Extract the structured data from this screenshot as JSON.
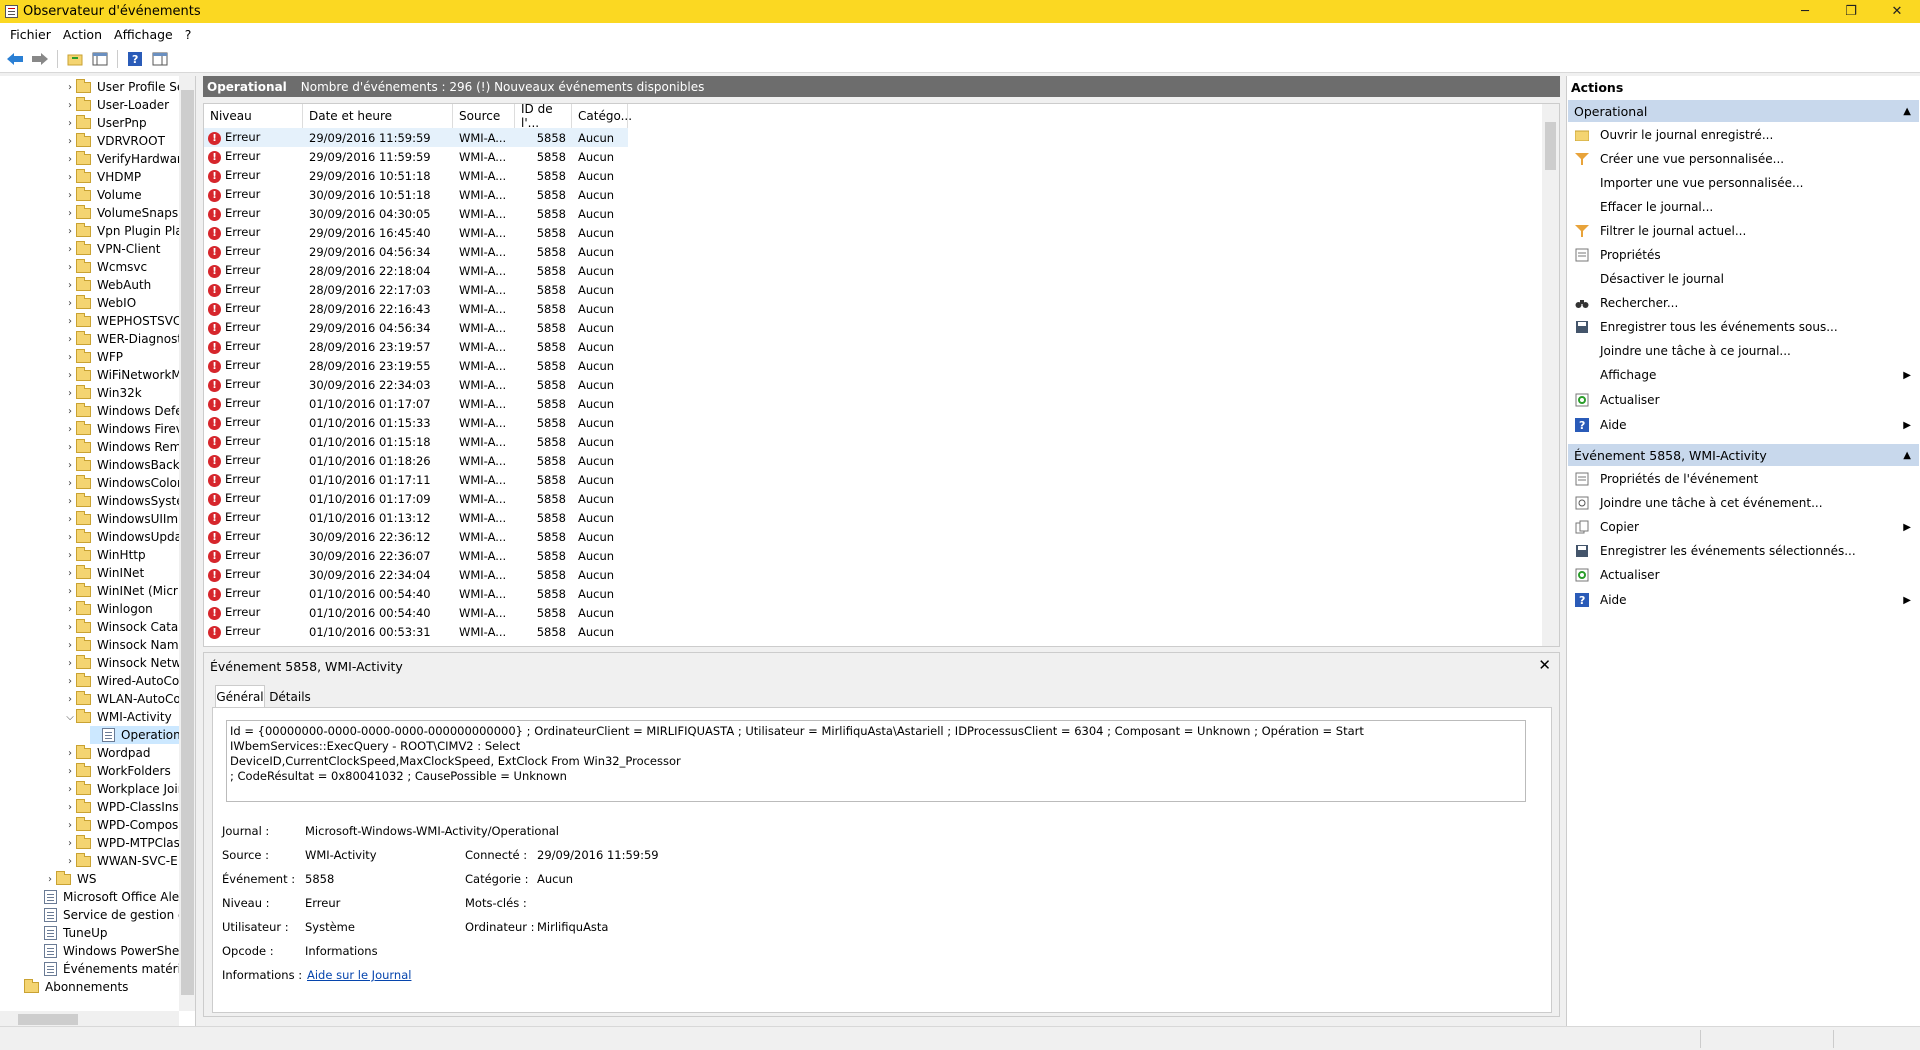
{
  "window": {
    "title": "Observateur d'événements",
    "minimize": "─",
    "maximize": "❐",
    "close": "✕"
  },
  "menu": [
    "Fichier",
    "Action",
    "Affichage",
    "?"
  ],
  "tree": {
    "items": [
      "User Profile Se",
      "User-Loader",
      "UserPnp",
      "VDRVROOT",
      "VerifyHardwar",
      "VHDMP",
      "Volume",
      "VolumeSnapsh",
      "Vpn Plugin Pla",
      "VPN-Client",
      "Wcmsvc",
      "WebAuth",
      "WebIO",
      "WEPHOSTSVC",
      "WER-Diagnost",
      "WFP",
      "WiFiNetworkM",
      "Win32k",
      "Windows Defe",
      "Windows Firev",
      "Windows Rem",
      "WindowsBack",
      "WindowsColor",
      "WindowsSyste",
      "WindowsUIIm",
      "WindowsUpda",
      "WinHttp",
      "WinINet",
      "WinINet (Micr",
      "Winlogon",
      "Winsock Catal",
      "Winsock Nam",
      "Winsock Netw",
      "Wired-AutoCo",
      "WLAN-AutoCo",
      "WMI-Activity"
    ],
    "selected_child": "Operationa",
    "after": [
      "Wordpad",
      "WorkFolders",
      "Workplace Joir",
      "WPD-ClassInst",
      "WPD-Compos",
      "WPD-MTPClas",
      "WWAN-SVC-E"
    ],
    "ws": "WS",
    "root_logs": [
      "Microsoft Office Alert",
      "Service de gestion de",
      "TuneUp",
      "Windows PowerShell",
      "Événements matériels"
    ],
    "subscriptions": "Abonnements"
  },
  "center": {
    "log_name": "Operational",
    "summary": "Nombre d'événements : 296 (!) Nouveaux événements disponibles",
    "columns": [
      "Niveau",
      "Date et heure",
      "Source",
      "ID de l'...",
      "Catégo..."
    ],
    "rows": [
      [
        "Erreur",
        "29/09/2016 11:59:59",
        "WMI-A...",
        "5858",
        "Aucun"
      ],
      [
        "Erreur",
        "29/09/2016 11:59:59",
        "WMI-A...",
        "5858",
        "Aucun"
      ],
      [
        "Erreur",
        "29/09/2016 10:51:18",
        "WMI-A...",
        "5858",
        "Aucun"
      ],
      [
        "Erreur",
        "30/09/2016 10:51:18",
        "WMI-A...",
        "5858",
        "Aucun"
      ],
      [
        "Erreur",
        "30/09/2016 04:30:05",
        "WMI-A...",
        "5858",
        "Aucun"
      ],
      [
        "Erreur",
        "29/09/2016 16:45:40",
        "WMI-A...",
        "5858",
        "Aucun"
      ],
      [
        "Erreur",
        "29/09/2016 04:56:34",
        "WMI-A...",
        "5858",
        "Aucun"
      ],
      [
        "Erreur",
        "28/09/2016 22:18:04",
        "WMI-A...",
        "5858",
        "Aucun"
      ],
      [
        "Erreur",
        "28/09/2016 22:17:03",
        "WMI-A...",
        "5858",
        "Aucun"
      ],
      [
        "Erreur",
        "28/09/2016 22:16:43",
        "WMI-A...",
        "5858",
        "Aucun"
      ],
      [
        "Erreur",
        "29/09/2016 04:56:34",
        "WMI-A...",
        "5858",
        "Aucun"
      ],
      [
        "Erreur",
        "28/09/2016 23:19:57",
        "WMI-A...",
        "5858",
        "Aucun"
      ],
      [
        "Erreur",
        "28/09/2016 23:19:55",
        "WMI-A...",
        "5858",
        "Aucun"
      ],
      [
        "Erreur",
        "30/09/2016 22:34:03",
        "WMI-A...",
        "5858",
        "Aucun"
      ],
      [
        "Erreur",
        "01/10/2016 01:17:07",
        "WMI-A...",
        "5858",
        "Aucun"
      ],
      [
        "Erreur",
        "01/10/2016 01:15:33",
        "WMI-A...",
        "5858",
        "Aucun"
      ],
      [
        "Erreur",
        "01/10/2016 01:15:18",
        "WMI-A...",
        "5858",
        "Aucun"
      ],
      [
        "Erreur",
        "01/10/2016 01:18:26",
        "WMI-A...",
        "5858",
        "Aucun"
      ],
      [
        "Erreur",
        "01/10/2016 01:17:11",
        "WMI-A...",
        "5858",
        "Aucun"
      ],
      [
        "Erreur",
        "01/10/2016 01:17:09",
        "WMI-A...",
        "5858",
        "Aucun"
      ],
      [
        "Erreur",
        "01/10/2016 01:13:12",
        "WMI-A...",
        "5858",
        "Aucun"
      ],
      [
        "Erreur",
        "30/09/2016 22:36:12",
        "WMI-A...",
        "5858",
        "Aucun"
      ],
      [
        "Erreur",
        "30/09/2016 22:36:07",
        "WMI-A...",
        "5858",
        "Aucun"
      ],
      [
        "Erreur",
        "30/09/2016 22:34:04",
        "WMI-A...",
        "5858",
        "Aucun"
      ],
      [
        "Erreur",
        "01/10/2016 00:54:40",
        "WMI-A...",
        "5858",
        "Aucun"
      ],
      [
        "Erreur",
        "01/10/2016 00:54:40",
        "WMI-A...",
        "5858",
        "Aucun"
      ],
      [
        "Erreur",
        "01/10/2016 00:53:31",
        "WMI-A...",
        "5858",
        "Aucun"
      ]
    ]
  },
  "detail": {
    "title": "Événement 5858, WMI-Activity",
    "tabs": [
      "Général",
      "Détails"
    ],
    "description_lines": [
      "Id = {00000000-0000-0000-0000-000000000000} ; OrdinateurClient = MIRLIFIQUASTA ; Utilisateur = MirlifiquAsta\\Astariell ; IDProcessusClient = 6304 ; Composant = Unknown ; Opération = Start IWbemServices::ExecQuery - ROOT\\CIMV2 : Select",
      "DeviceID,CurrentClockSpeed,MaxClockSpeed, ExtClock From Win32_Processor",
      "; CodeRésultat = 0x80041032 ; CausePossible = Unknown"
    ],
    "fields": {
      "journal_label": "Journal :",
      "journal": "Microsoft-Windows-WMI-Activity/Operational",
      "source_label": "Source :",
      "source": "WMI-Activity",
      "connecte_label": "Connecté :",
      "connecte": "29/09/2016 11:59:59",
      "evenement_label": "Événement :",
      "evenement": "5858",
      "categorie_label": "Catégorie :",
      "categorie": "Aucun",
      "niveau_label": "Niveau :",
      "niveau": "Erreur",
      "motscles_label": "Mots-clés :",
      "motscles": "",
      "utilisateur_label": "Utilisateur :",
      "utilisateur": "Système",
      "ordinateur_label": "Ordinateur :",
      "ordinateur": "MirlifiquAsta",
      "opcode_label": "Opcode :",
      "opcode": "Informations",
      "infos_label": "Informations :",
      "infos_link": "Aide sur le Journal"
    }
  },
  "actions": {
    "title": "Actions",
    "section1": "Operational",
    "items1": [
      {
        "label": "Ouvrir le journal enregistré...",
        "icon": "folder-open-icon"
      },
      {
        "label": "Créer une vue personnalisée...",
        "icon": "filter-icon"
      },
      {
        "label": "Importer une vue personnalisée...",
        "icon": ""
      },
      {
        "label": "Effacer le journal...",
        "icon": ""
      },
      {
        "label": "Filtrer le journal actuel...",
        "icon": "filter-icon"
      },
      {
        "label": "Propriétés",
        "icon": "properties-icon"
      },
      {
        "label": "Désactiver le journal",
        "icon": ""
      },
      {
        "label": "Rechercher...",
        "icon": "binoculars-icon"
      },
      {
        "label": "Enregistrer tous les événements sous...",
        "icon": "save-icon"
      },
      {
        "label": "Joindre une tâche à ce journal...",
        "icon": ""
      },
      {
        "label": "Affichage",
        "icon": "",
        "submenu": true
      },
      {
        "label": "Actualiser",
        "icon": "refresh-icon"
      },
      {
        "label": "Aide",
        "icon": "help-icon",
        "submenu": true
      }
    ],
    "section2": "Événement 5858, WMI-Activity",
    "items2": [
      {
        "label": "Propriétés de l'événement",
        "icon": "properties-icon"
      },
      {
        "label": "Joindre une tâche à cet événement...",
        "icon": "task-icon"
      },
      {
        "label": "Copier",
        "icon": "copy-icon",
        "submenu": true
      },
      {
        "label": "Enregistrer les événements sélectionnés...",
        "icon": "save-icon"
      },
      {
        "label": "Actualiser",
        "icon": "refresh-icon"
      },
      {
        "label": "Aide",
        "icon": "help-icon",
        "submenu": true
      }
    ]
  },
  "colors": {
    "titlebar": "#fbd822",
    "header": "#6d6d6d",
    "section": "#c8d8ec",
    "error": "#d6262c"
  }
}
